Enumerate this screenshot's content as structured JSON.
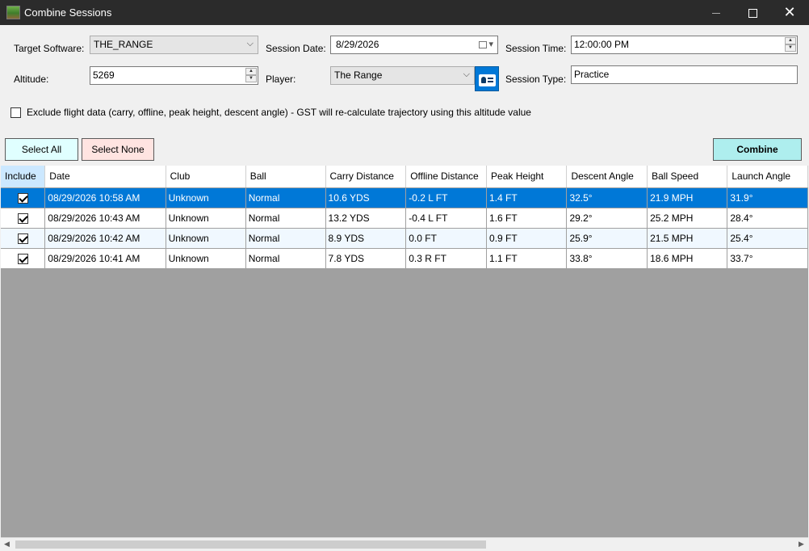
{
  "window": {
    "title": "Combine Sessions",
    "icon": "golf-course-icon"
  },
  "form": {
    "target_software_label": "Target Software:",
    "target_software_value": "THE_RANGE",
    "session_date_label": "Session Date:",
    "session_date_value": "8/29/2026",
    "session_time_label": "Session Time:",
    "session_time_value": "12:00:00 PM",
    "altitude_label": "Altitude:",
    "altitude_value": "5269",
    "player_label": "Player:",
    "player_value": "The Range",
    "session_type_label": "Session Type:",
    "session_type_value": "Practice",
    "exclude_label": "Exclude flight data (carry, offline, peak height, descent angle) - GST will re-calculate trajectory using this altitude value",
    "exclude_checked": false
  },
  "buttons": {
    "select_all": "Select All",
    "select_none": "Select None",
    "combine": "Combine"
  },
  "table": {
    "columns": [
      "Include",
      "Date",
      "Club",
      "Ball",
      "Carry Distance",
      "Offline Distance",
      "Peak Height",
      "Descent Angle",
      "Ball Speed",
      "Launch Angle"
    ],
    "rows": [
      {
        "include": true,
        "date": "08/29/2026 10:58 AM",
        "club": "Unknown",
        "ball": "Normal",
        "carry": "10.6 YDS",
        "offline": "-0.2 L FT",
        "peak": "1.4 FT",
        "descent": "32.5°",
        "speed": "21.9 MPH",
        "launch": "31.9°"
      },
      {
        "include": true,
        "date": "08/29/2026 10:43 AM",
        "club": "Unknown",
        "ball": "Normal",
        "carry": "13.2 YDS",
        "offline": "-0.4 L FT",
        "peak": "1.6 FT",
        "descent": "29.2°",
        "speed": "25.2 MPH",
        "launch": "28.4°"
      },
      {
        "include": true,
        "date": "08/29/2026 10:42 AM",
        "club": "Unknown",
        "ball": "Normal",
        "carry": "8.9 YDS",
        "offline": "0.0 FT",
        "peak": "0.9 FT",
        "descent": "25.9°",
        "speed": "21.5 MPH",
        "launch": "25.4°"
      },
      {
        "include": true,
        "date": "08/29/2026 10:41 AM",
        "club": "Unknown",
        "ball": "Normal",
        "carry": "7.8 YDS",
        "offline": "0.3 R FT",
        "peak": "1.1 FT",
        "descent": "33.8°",
        "speed": "18.6 MPH",
        "launch": "33.7°"
      }
    ],
    "selected_row": 0
  },
  "colors": {
    "titlebar": "#2b2b2b",
    "selection": "#0078d7",
    "select_all_bg": "#e0ffff",
    "select_none_bg": "#ffe4e1",
    "combine_bg": "#aeeeee"
  }
}
